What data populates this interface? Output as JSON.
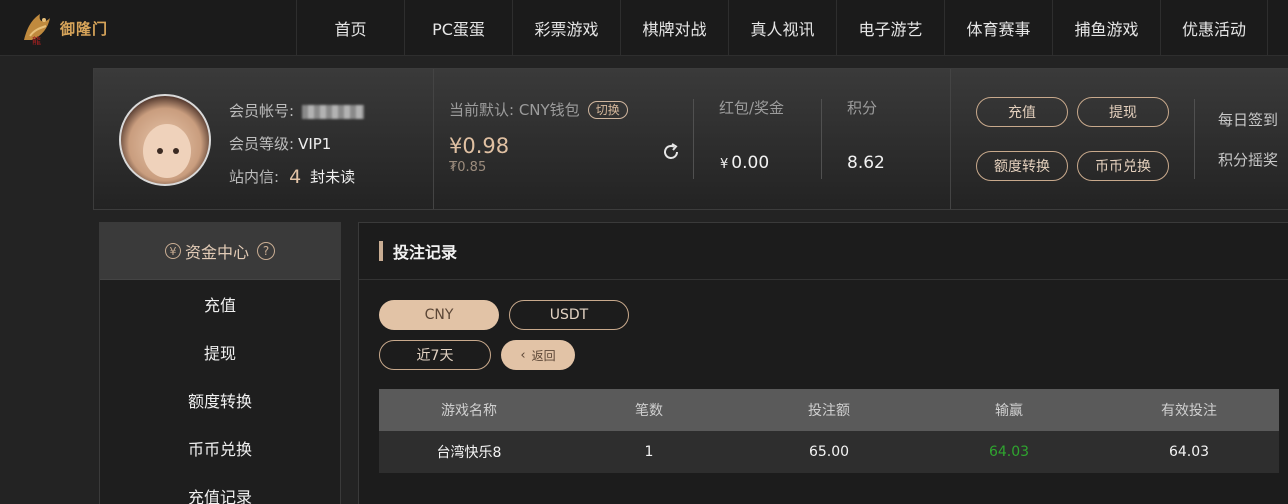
{
  "brand": {
    "logo_text": "御隆门"
  },
  "nav": [
    "首页",
    "PC蛋蛋",
    "彩票游戏",
    "棋牌对战",
    "真人视讯",
    "电子游艺",
    "体育赛事",
    "捕鱼游戏",
    "优惠活动"
  ],
  "member": {
    "account_label": "会员帐号:",
    "level_label": "会员等级:",
    "level_value": "VIP1",
    "msg_label": "站内信:",
    "unread_count": "4",
    "unread_suffix": "封未读"
  },
  "wallet": {
    "default_label": "当前默认: CNY钱包",
    "switch_label": "切换",
    "balance": "¥0.98",
    "balance_sub": "₮0.85"
  },
  "stats": {
    "bonus_label": "红包/奖金",
    "bonus_currency": "¥",
    "bonus_value": "0.00",
    "points_label": "积分",
    "points_value": "8.62"
  },
  "actions": {
    "deposit": "充值",
    "withdraw": "提现",
    "transfer": "额度转换",
    "exchange": "币币兑换",
    "daily_signin": "每日签到",
    "points_lottery": "积分摇奖"
  },
  "sidebar": {
    "title": "资金中心",
    "coin_glyph": "¥",
    "help_glyph": "?",
    "items": [
      "充值",
      "提现",
      "额度转换",
      "币币兑换",
      "充值记录"
    ]
  },
  "main": {
    "title": "投注记录",
    "tabs": [
      "CNY",
      "USDT"
    ],
    "active_tab": "CNY",
    "range": "近7天",
    "back": "返回",
    "back_glyph": "‹",
    "columns": [
      "游戏名称",
      "笔数",
      "投注额",
      "输赢",
      "有效投注"
    ],
    "rows": [
      {
        "game": "台湾快乐8",
        "count": "1",
        "bet": "65.00",
        "win": "64.03",
        "valid": "64.03"
      }
    ]
  },
  "colors": {
    "accent": "#e2c3a6",
    "win_green": "#2fa52f",
    "background": "#232323"
  }
}
